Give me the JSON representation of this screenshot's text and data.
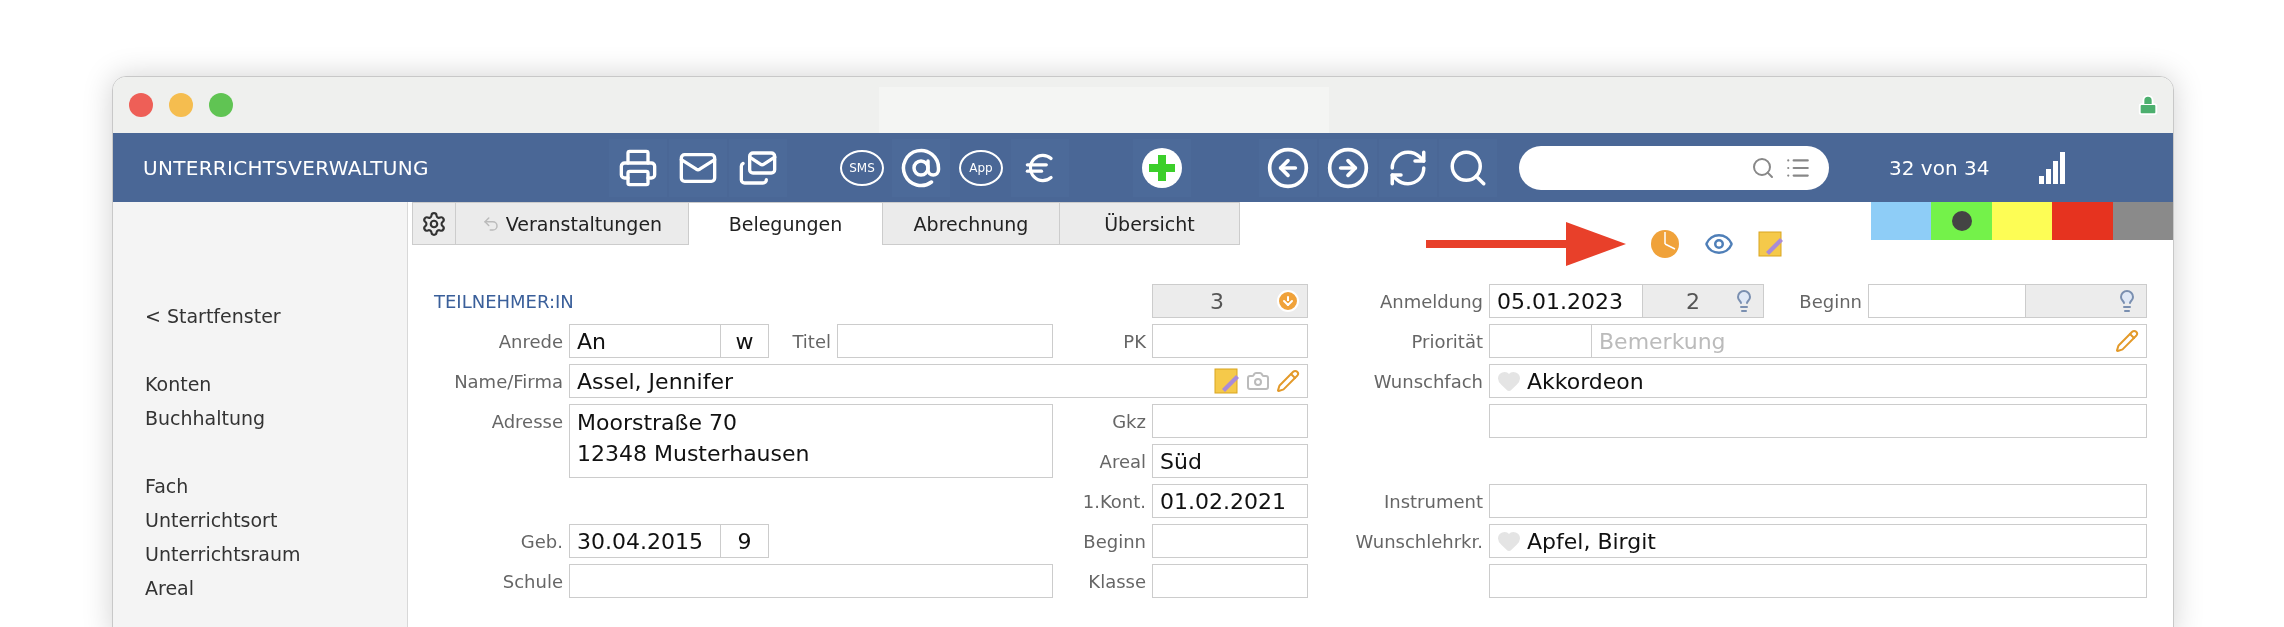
{
  "app_title": "UNTERRICHTSVERWALTUNG",
  "toolbar": {
    "sms_label": "SMS",
    "app_label": "App"
  },
  "record_counter": "32 von 34",
  "sidebar": {
    "groups": [
      {
        "items": [
          "< Startfenster"
        ]
      },
      {
        "items": [
          "Konten",
          "Buchhaltung"
        ]
      },
      {
        "items": [
          "Fach",
          "Unterrichtsort",
          "Unterrichtsraum",
          "Areal"
        ]
      }
    ]
  },
  "tabs": [
    {
      "label": "Veranstaltungen",
      "selected": false
    },
    {
      "label": "Belegungen",
      "selected": true
    },
    {
      "label": "Abrechnung",
      "selected": false
    },
    {
      "label": "Übersicht",
      "selected": false
    }
  ],
  "color_tags": [
    {
      "color": "#8ecdf7",
      "selected": false
    },
    {
      "color": "#74f24a",
      "selected": true
    },
    {
      "color": "#fdfd55",
      "selected": false
    },
    {
      "color": "#e6331f",
      "selected": false
    },
    {
      "color": "#8a8a8a",
      "selected": false
    }
  ],
  "participant": {
    "heading": "TEILNEHMER:IN",
    "count": "3",
    "salutation": {
      "label": "Anrede",
      "value": "An",
      "gender": "w"
    },
    "title": {
      "label": "Titel"
    },
    "pk": {
      "label": "PK"
    },
    "name": {
      "label": "Name/Firma",
      "value": "Assel, Jennifer"
    },
    "address": {
      "label": "Adresse",
      "lines": [
        "Moorstraße 70",
        "12348 Musterhausen"
      ]
    },
    "gkz": {
      "label": "Gkz"
    },
    "area": {
      "label": "Areal",
      "value": "Süd"
    },
    "first_contact": {
      "label": "1.Kont.",
      "value": "01.02.2021"
    },
    "birth": {
      "label": "Geb.",
      "value": "30.04.2015",
      "age": "9"
    },
    "start": {
      "label": "Beginn"
    },
    "school": {
      "label": "Schule"
    },
    "class": {
      "label": "Klasse"
    }
  },
  "registration": {
    "date": {
      "label": "Anmeldung",
      "value": "05.01.2023"
    },
    "count": "2",
    "start": {
      "label": "Beginn"
    },
    "priority": {
      "label": "Priorität"
    },
    "remark": {
      "placeholder": "Bemerkung"
    },
    "wish_subject": {
      "label": "Wunschfach",
      "value": "Akkordeon",
      "favorite": false
    },
    "instrument": {
      "label": "Instrument"
    },
    "wish_teacher": {
      "label": "Wunschlehrkr.",
      "value": "Apfel, Birgit",
      "favorite": false
    }
  }
}
